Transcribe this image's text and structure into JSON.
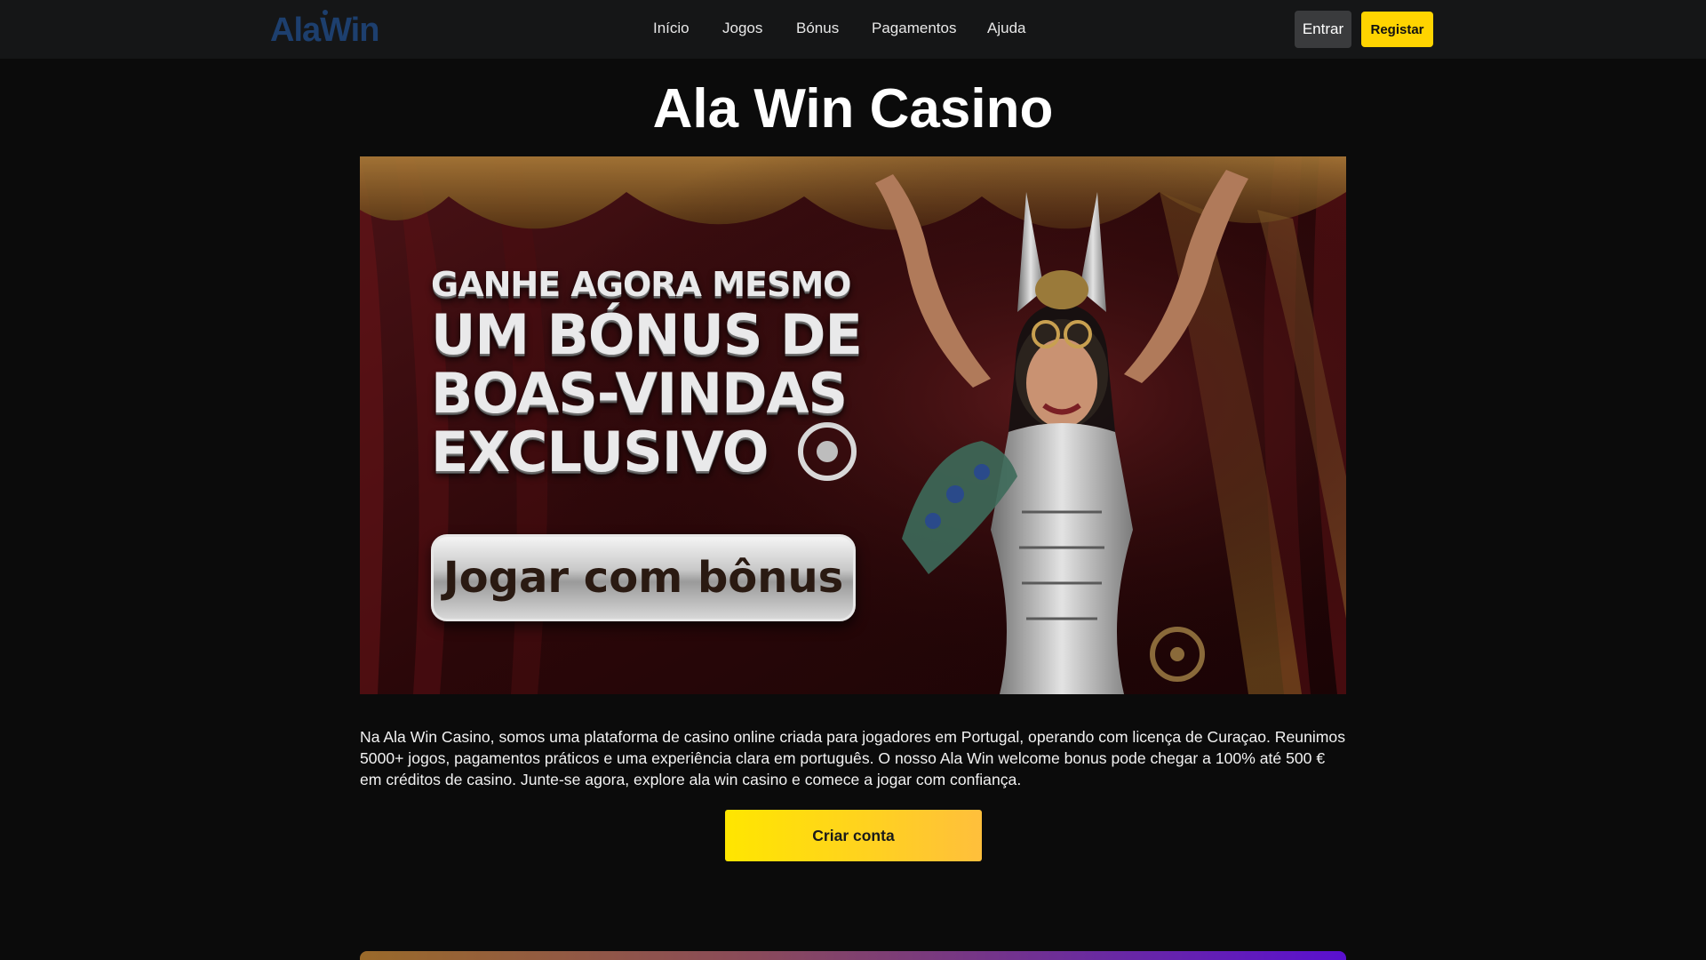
{
  "header": {
    "logo_text": "AlaWin",
    "nav": [
      {
        "label": "Início"
      },
      {
        "label": "Jogos"
      },
      {
        "label": "Bónus"
      },
      {
        "label": "Pagamentos"
      },
      {
        "label": "Ajuda"
      }
    ],
    "login_label": "Entrar",
    "register_label": "Registar"
  },
  "main": {
    "title": "Ala Win Casino",
    "banner": {
      "line1": "GANHE AGORA MESMO",
      "line2": "UM BÓNUS DE",
      "line3": "BOAS-VINDAS",
      "line4": "EXCLUSIVO",
      "cta_label": "Jogar com bônus"
    },
    "description": "Na Ala Win Casino, somos uma plataforma de casino online criada para jogadores em Portugal, operando com licença de Curaçao. Reunimos 5000+ jogos, pagamentos práticos e uma experiência clara em português. O nosso Ala Win welcome bonus pode chegar a 100% até 500 € em créditos de casino. Junte-se agora, explore ala win casino e comece a jogar com confiança.",
    "create_account_label": "Criar conta"
  },
  "colors": {
    "background": "#0b0b0b",
    "header": "#151617",
    "accent": "#ffd400",
    "logo": "#1d3f6e"
  }
}
